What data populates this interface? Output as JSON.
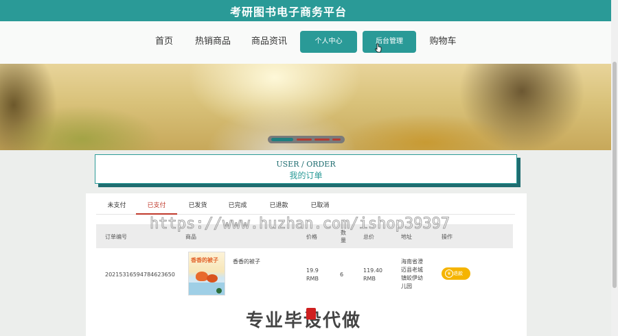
{
  "header": {
    "site_title": "考研图书电子商务平台"
  },
  "nav": {
    "items": [
      {
        "label": "首页",
        "active": false
      },
      {
        "label": "热销商品",
        "active": false
      },
      {
        "label": "商品资讯",
        "active": false
      },
      {
        "label": "个人中心",
        "active": true
      },
      {
        "label": "后台管理",
        "active": true
      },
      {
        "label": "购物车",
        "active": false
      }
    ]
  },
  "page_heading": {
    "en": "USER / ORDER",
    "cn": "我的订单"
  },
  "tabs": [
    {
      "label": "未支付"
    },
    {
      "label": "已支付",
      "selected": true
    },
    {
      "label": "已发货"
    },
    {
      "label": "已完成"
    },
    {
      "label": "已退款"
    },
    {
      "label": "已取消"
    }
  ],
  "table": {
    "headers": {
      "order_no": "订单编号",
      "product": "商品",
      "price": "价格",
      "qty_line1": "数",
      "qty_line2": "量",
      "total": "总价",
      "address": "地址",
      "action": "操作"
    },
    "rows": [
      {
        "order_no": "20215316594784623650",
        "book_cover_title": "香香的被子",
        "product_name": "香香的被子",
        "price_value": "19.9",
        "price_unit": "RMB",
        "qty": "6",
        "total_value": "119.40",
        "total_unit": "RMB",
        "address_lines": [
          "海南省澄",
          "迈县老城",
          "镇蛟伊幼",
          "儿园"
        ],
        "action_label": "退款"
      }
    ]
  },
  "watermark": {
    "url": "https://www.huzhan.com/ishop39397",
    "slogan_a": "专业毕",
    "slogan_b": "设代做"
  },
  "colors": {
    "primary": "#2a9a97",
    "primary_dark": "#1f6d70",
    "active_tab": "#c0392b",
    "refund": "#f5b400"
  }
}
